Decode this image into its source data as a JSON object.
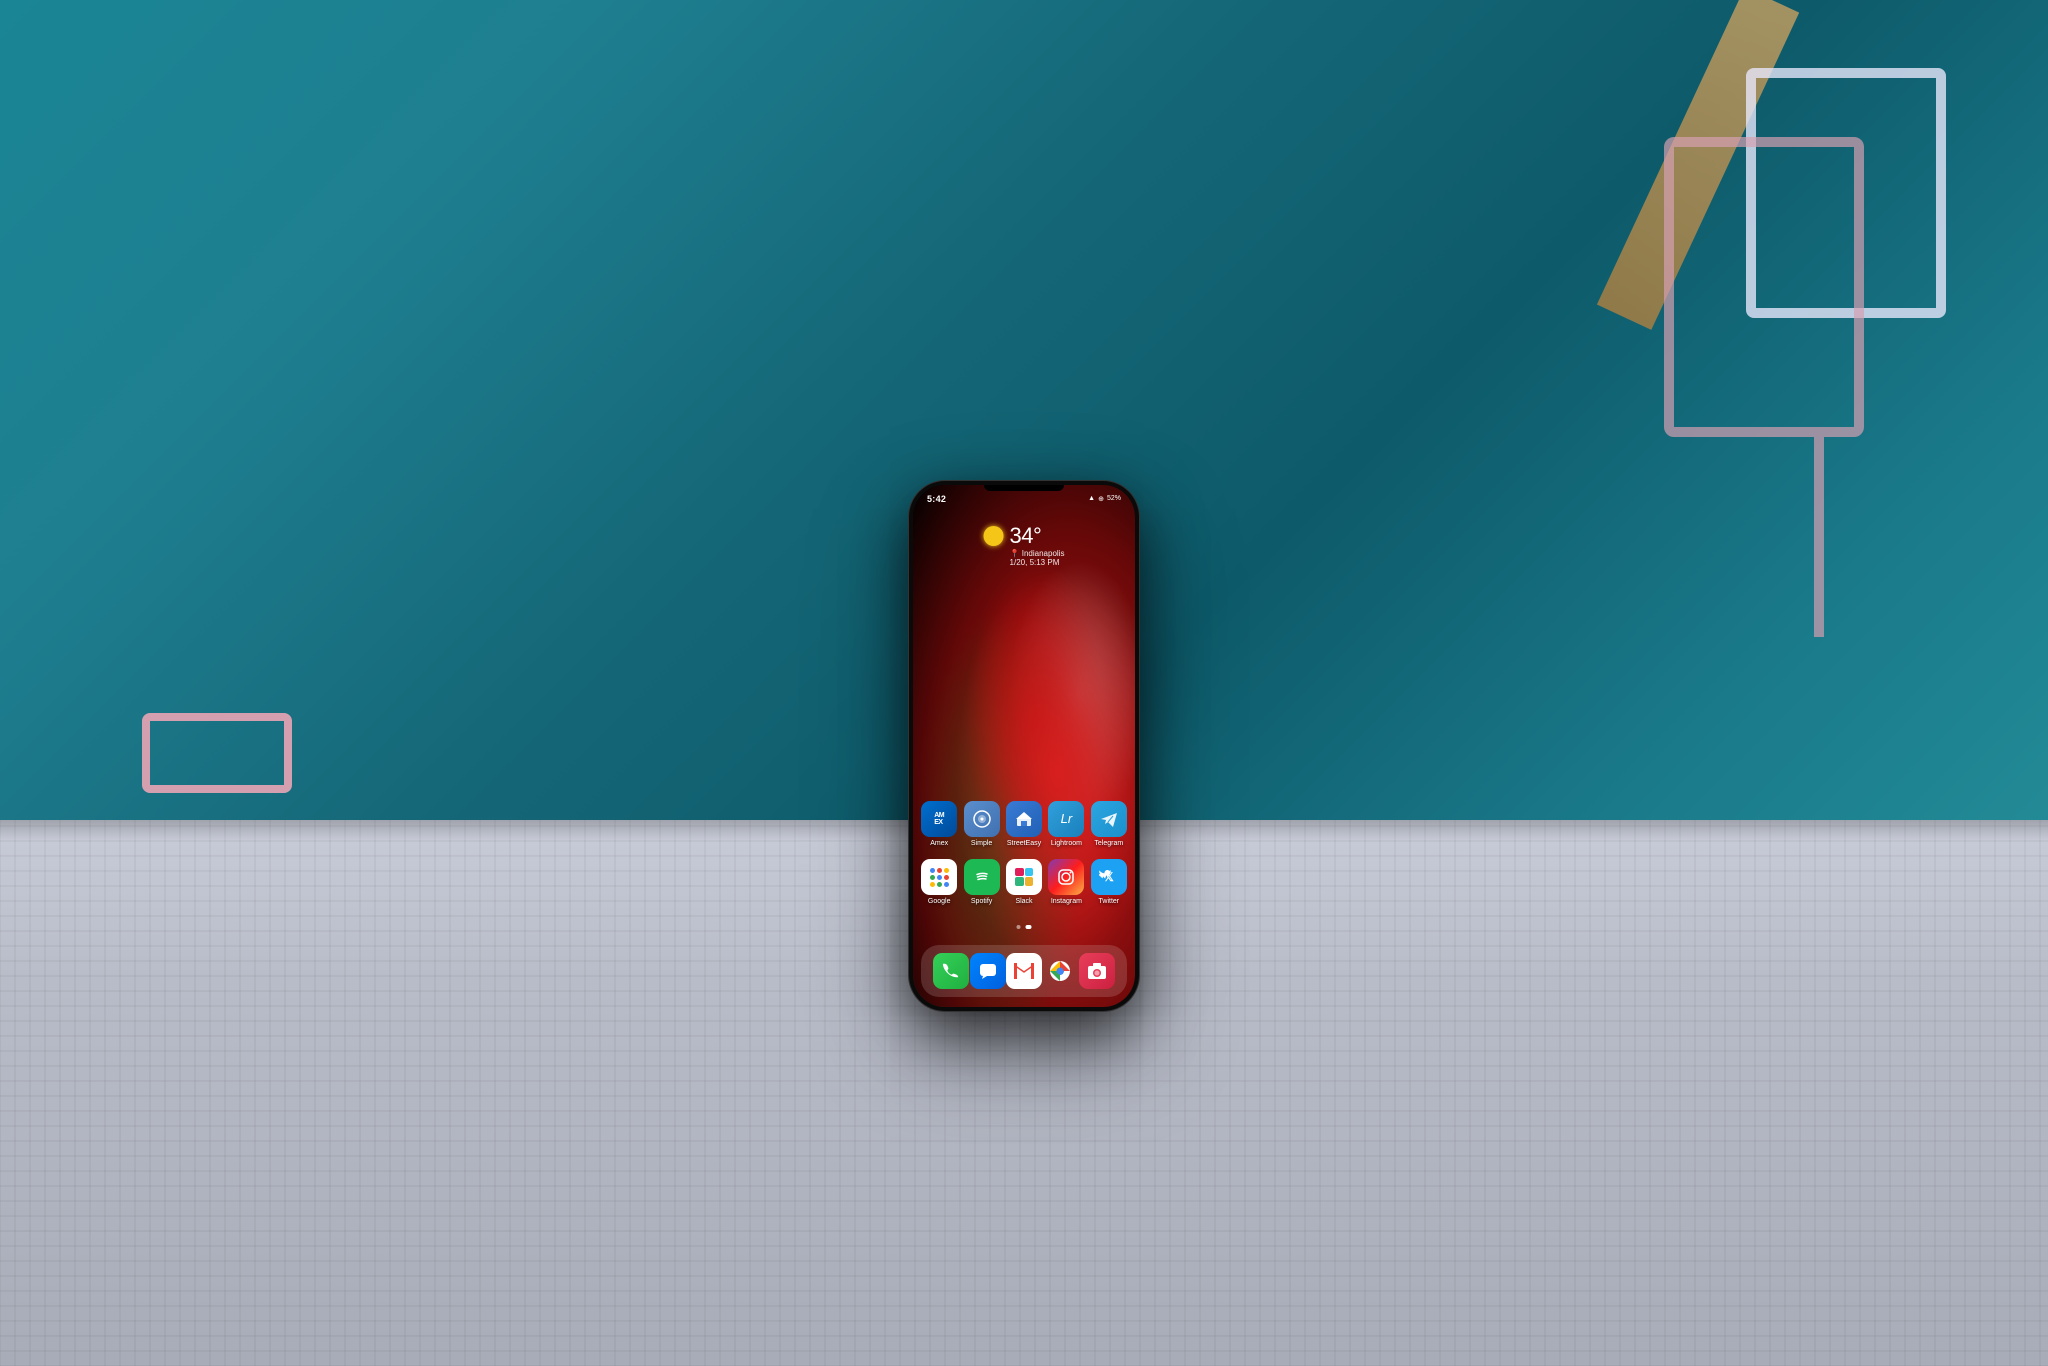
{
  "scene": {
    "background_color": "#1a7a8a",
    "description": "Samsung phone on metal mesh table with pink chairs in background"
  },
  "phone": {
    "status_bar": {
      "time": "5:42",
      "battery": "52%",
      "icons": [
        "signal",
        "wifi",
        "location",
        "nfc",
        "battery"
      ]
    },
    "weather": {
      "temperature": "34°",
      "condition": "Sunny",
      "city": "Indianapolis",
      "date": "1/20, 5:13 PM"
    },
    "app_rows": [
      {
        "apps": [
          {
            "id": "amex",
            "label": "Amex",
            "icon_type": "amex"
          },
          {
            "id": "simple",
            "label": "Simple",
            "icon_type": "simple"
          },
          {
            "id": "streeteasy",
            "label": "StreetEasy",
            "icon_type": "streeteasy"
          },
          {
            "id": "lightroom",
            "label": "Lightroom",
            "icon_type": "lightroom"
          },
          {
            "id": "telegram",
            "label": "Telegram",
            "icon_type": "telegram"
          }
        ]
      },
      {
        "apps": [
          {
            "id": "google",
            "label": "Google",
            "icon_type": "google"
          },
          {
            "id": "spotify",
            "label": "Spotify",
            "icon_type": "spotify"
          },
          {
            "id": "slack",
            "label": "Slack",
            "icon_type": "slack"
          },
          {
            "id": "instagram",
            "label": "Instagram",
            "icon_type": "instagram"
          },
          {
            "id": "twitter",
            "label": "Twitter",
            "icon_type": "twitter"
          }
        ]
      }
    ],
    "dock_apps": [
      {
        "id": "phone",
        "label": "Phone",
        "icon_type": "dock-phone"
      },
      {
        "id": "messages",
        "label": "Messages",
        "icon_type": "dock-messages"
      },
      {
        "id": "gmail",
        "label": "Gmail",
        "icon_type": "dock-gmail"
      },
      {
        "id": "chrome",
        "label": "Chrome",
        "icon_type": "dock-chrome"
      },
      {
        "id": "camera",
        "label": "Camera",
        "icon_type": "dock-camera"
      }
    ],
    "page_indicators": [
      {
        "active": false
      },
      {
        "active": true
      }
    ]
  }
}
